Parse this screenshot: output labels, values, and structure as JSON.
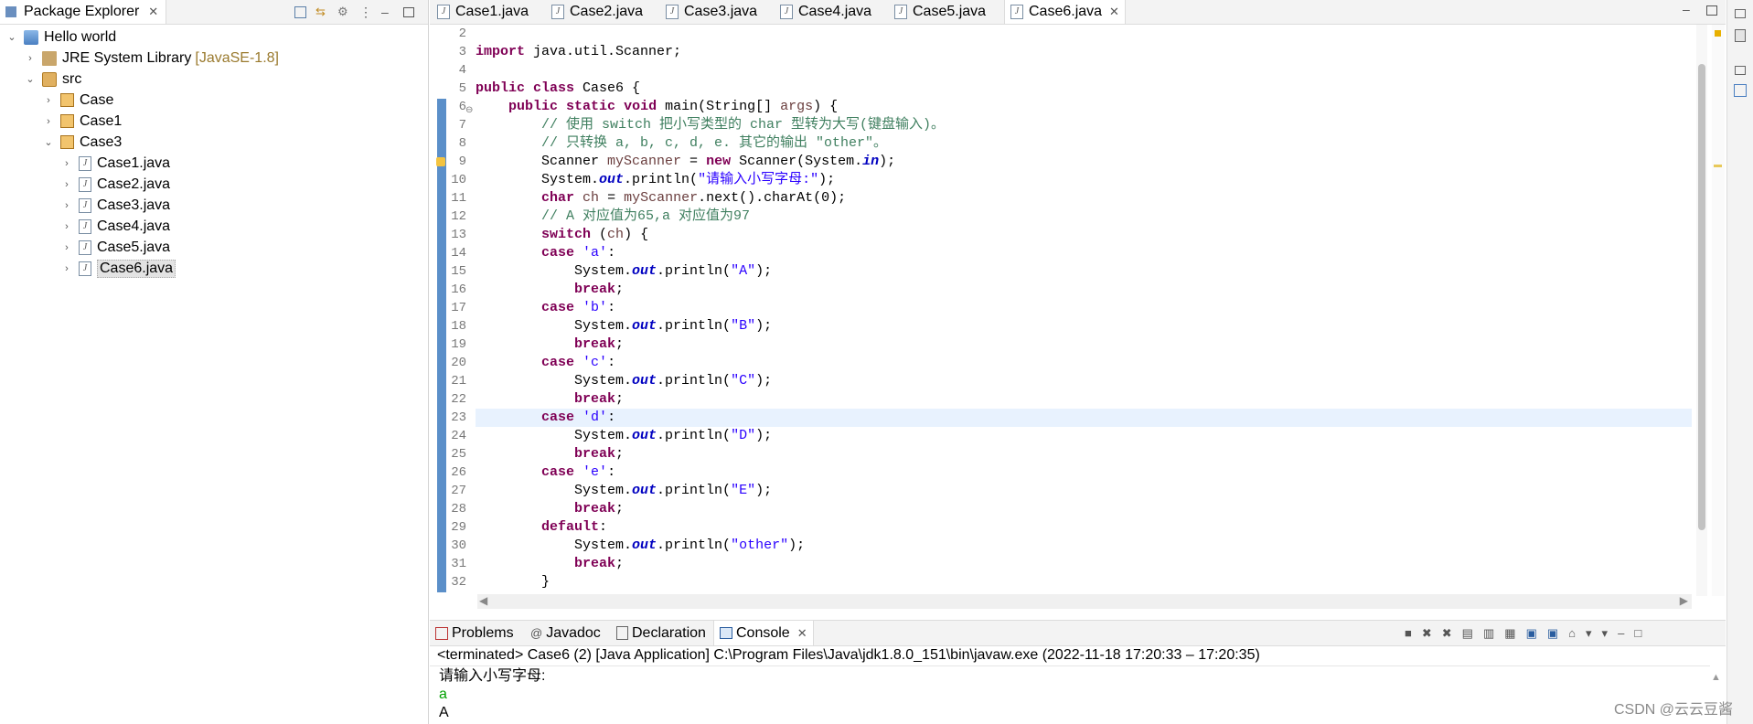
{
  "explorer": {
    "title": "Package Explorer",
    "tree": [
      {
        "label": "Hello world",
        "level": 0,
        "twisty": "expanded",
        "icon": "project-icon"
      },
      {
        "label": "JRE System Library",
        "suffix": "[JavaSE-1.8]",
        "level": 1,
        "twisty": "collapsed",
        "icon": "library-icon"
      },
      {
        "label": "src",
        "level": 1,
        "twisty": "expanded",
        "icon": "source-folder-icon"
      },
      {
        "label": "Case",
        "level": 2,
        "twisty": "collapsed",
        "icon": "package-icon"
      },
      {
        "label": "Case1",
        "level": 2,
        "twisty": "collapsed",
        "icon": "package-icon"
      },
      {
        "label": "Case3",
        "level": 2,
        "twisty": "expanded",
        "icon": "package-icon"
      },
      {
        "label": "Case1.java",
        "level": 3,
        "twisty": "collapsed",
        "icon": "java-file-icon"
      },
      {
        "label": "Case2.java",
        "level": 3,
        "twisty": "collapsed",
        "icon": "java-file-icon"
      },
      {
        "label": "Case3.java",
        "level": 3,
        "twisty": "collapsed",
        "icon": "java-file-icon"
      },
      {
        "label": "Case4.java",
        "level": 3,
        "twisty": "collapsed",
        "icon": "java-file-icon"
      },
      {
        "label": "Case5.java",
        "level": 3,
        "twisty": "collapsed",
        "icon": "java-file-icon"
      },
      {
        "label": "Case6.java",
        "level": 3,
        "twisty": "collapsed",
        "icon": "java-file-icon",
        "selected": true
      }
    ]
  },
  "editor": {
    "tabs": [
      "Case1.java",
      "Case2.java",
      "Case3.java",
      "Case4.java",
      "Case5.java",
      "Case6.java"
    ],
    "active_tab": "Case6.java",
    "line_numbers": [
      "2",
      "3",
      "4",
      "5",
      "6",
      "7",
      "8",
      "9",
      "10",
      "11",
      "12",
      "13",
      "14",
      "15",
      "16",
      "17",
      "18",
      "19",
      "20",
      "21",
      "22",
      "23",
      "24",
      "25",
      "26",
      "27",
      "28",
      "29",
      "30",
      "31",
      "32"
    ],
    "highlighted_line": "23",
    "code": [
      "",
      "import java.util.Scanner;",
      "",
      "public class Case6 {",
      "    public static void main(String[] args) {",
      "        // 使用 switch 把小写类型的 char 型转为大写(键盘输入)。",
      "        // 只转换 a, b, c, d, e. 其它的输出 \"other\"。",
      "        Scanner myScanner = new Scanner(System.in);",
      "        System.out.println(\"请输入小写字母:\");",
      "        char ch = myScanner.next().charAt(0);",
      "        // A 对应值为65,a 对应值为97",
      "        switch (ch) {",
      "        case 'a':",
      "            System.out.println(\"A\");",
      "            break;",
      "        case 'b':",
      "            System.out.println(\"B\");",
      "            break;",
      "        case 'c':",
      "            System.out.println(\"C\");",
      "            break;",
      "        case 'd':",
      "            System.out.println(\"D\");",
      "            break;",
      "        case 'e':",
      "            System.out.println(\"E\");",
      "            break;",
      "        default:",
      "            System.out.println(\"other\");",
      "            break;",
      "        }"
    ]
  },
  "console": {
    "tabs": [
      "Problems",
      "Javadoc",
      "Declaration",
      "Console"
    ],
    "active_tab": "Console",
    "header": "<terminated> Case6 (2) [Java Application] C:\\Program Files\\Java\\jdk1.8.0_151\\bin\\javaw.exe  (2022-11-18 17:20:33 – 17:20:35)",
    "output": [
      {
        "text": "请输入小写字母:",
        "kind": "stdout"
      },
      {
        "text": "a",
        "kind": "stdin"
      },
      {
        "text": "A",
        "kind": "stdout"
      }
    ]
  },
  "watermark": "CSDN @云云豆酱",
  "colors": {
    "keyword": "#7f0055",
    "comment": "#3f7f5f",
    "string": "#2a00ff",
    "field": "#0000c0",
    "stdin": "#00a000",
    "line_highlight": "#e8f2fe",
    "ruler": "#5b8fc9"
  }
}
